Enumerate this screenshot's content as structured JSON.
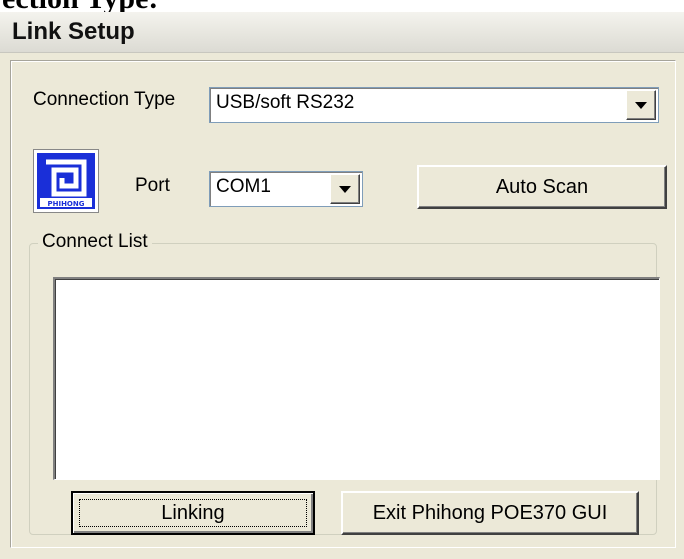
{
  "doc_fragment": "ection Type:",
  "window": {
    "title": "Link Setup"
  },
  "connection": {
    "label": "Connection Type",
    "value": "USB/soft RS232"
  },
  "port": {
    "label": "Port",
    "value": "COM1"
  },
  "buttons": {
    "auto_scan": "Auto Scan",
    "linking": "Linking",
    "exit": "Exit Phihong POE370 GUI"
  },
  "connect_list": {
    "label": "Connect List",
    "items": []
  },
  "logo": {
    "icon": "phihong-logo",
    "text": "PHIHONG"
  }
}
